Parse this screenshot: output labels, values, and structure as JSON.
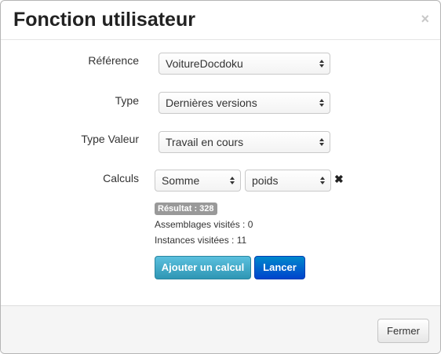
{
  "dialog": {
    "title": "Fonction utilisateur",
    "close_glyph": "×"
  },
  "form": {
    "reference": {
      "label": "Référence",
      "value": "VoitureDocdoku"
    },
    "type": {
      "label": "Type",
      "value": "Dernières versions"
    },
    "type_valeur": {
      "label": "Type Valeur",
      "value": "Travail en cours"
    },
    "calculs": {
      "label": "Calculs",
      "operation": "Somme",
      "attribute": "poids",
      "remove_glyph": "✖"
    }
  },
  "results": {
    "badge": "Résultat : 328",
    "assemblages": "Assemblages visités : 0",
    "instances": "Instances visitées : 11"
  },
  "actions": {
    "add_calc": "Ajouter un calcul",
    "run": "Lancer"
  },
  "footer": {
    "close_label": "Fermer"
  },
  "icons": {
    "select_arrows": "select-arrows-icon",
    "close": "close-icon",
    "remove": "remove-icon"
  },
  "colors": {
    "info_button": "#2f96b4",
    "primary_button": "#0044cc",
    "badge": "#999999"
  }
}
